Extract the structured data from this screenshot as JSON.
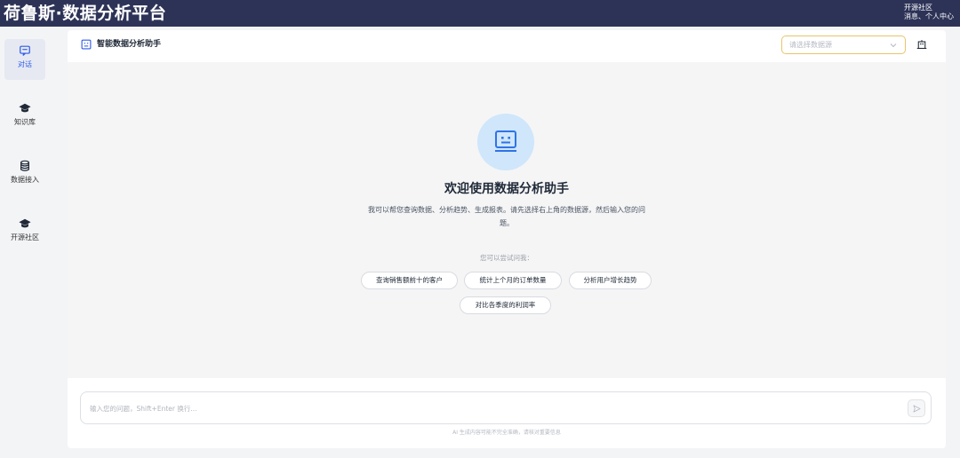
{
  "app": {
    "brand": "荷鲁斯·数据分析平台",
    "top_links": [
      "开源社区",
      "消息、个人中心"
    ]
  },
  "sidebar": {
    "items": [
      {
        "label": "对话",
        "icon": "chat-icon",
        "active": true
      },
      {
        "label": "知识库",
        "icon": "graduation-cap-icon",
        "active": false
      },
      {
        "label": "数据接入",
        "icon": "database-icon",
        "active": false
      },
      {
        "label": "开源社区",
        "icon": "graduation-cap-icon",
        "active": false
      }
    ]
  },
  "header": {
    "icon": "robot-icon",
    "title": "智能数据分析助手",
    "datasource_placeholder": "请选择数据源",
    "settings_icon": "building-icon"
  },
  "welcome": {
    "icon": "robot-icon",
    "title": "欢迎使用数据分析助手",
    "description": "我可以帮您查询数据、分析趋势、生成报表。请先选择右上角的数据源，然后输入您的问题。",
    "try_label": "您可以尝试问我：",
    "suggestions": [
      "查询销售额前十的客户",
      "统计上个月的订单数量",
      "分析用户增长趋势",
      "对比各季度的利润率"
    ]
  },
  "composer": {
    "placeholder": "输入您的问题，Shift+Enter 换行...",
    "send_icon": "send-icon",
    "disclaimer": "AI 生成内容可能不完全准确，请核对重要信息"
  },
  "colors": {
    "topbar": "#2d3357",
    "accent": "#2f5bea",
    "hero_circle": "#cfe6fb",
    "select_border": "#e8c56a"
  }
}
